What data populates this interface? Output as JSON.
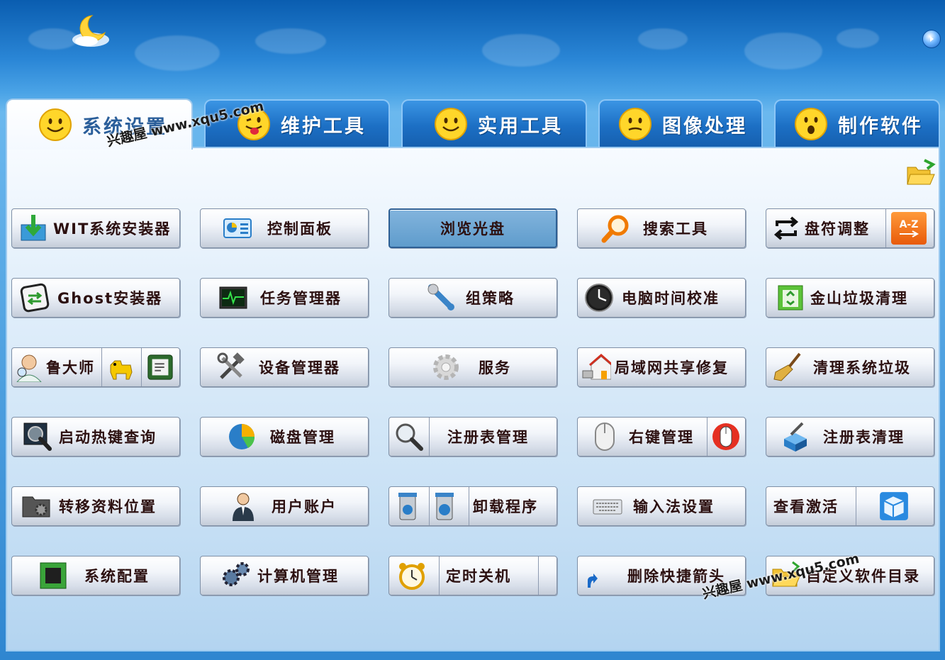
{
  "tabs": [
    {
      "label": "系统设置",
      "active": true
    },
    {
      "label": "维护工具",
      "active": false
    },
    {
      "label": "实用工具",
      "active": false
    },
    {
      "label": "图像处理",
      "active": false
    },
    {
      "label": "制作软件",
      "active": false
    }
  ],
  "watermark": "兴趣屋 www.xqu5.com",
  "buttons": {
    "wit": "WIT系统安装器",
    "control_panel": "控制面板",
    "browse_disc": "浏览光盘",
    "search_tool": "搜索工具",
    "drive_letter": "盘符调整",
    "az": "A-Z",
    "ghost": "Ghost安装器",
    "task_manager": "任务管理器",
    "group_policy": "组策略",
    "time_sync": "电脑时间校准",
    "kingsoft_clean": "金山垃圾清理",
    "ludashi": "鲁大师",
    "device_manager": "设备管理器",
    "services": "服务",
    "lan_repair": "局域网共享修复",
    "clean_junk": "清理系统垃圾",
    "hotkey": "启动热键查询",
    "disk_manager": "磁盘管理",
    "regedit": "注册表管理",
    "right_click": "右键管理",
    "reg_clean": "注册表清理",
    "move_data": "转移资料位置",
    "user_account": "用户账户",
    "uninstall": "卸载程序",
    "ime": "输入法设置",
    "activation": "查看激活",
    "sys_config": "系统配置",
    "comp_manage": "计算机管理",
    "shutdown": "定时关机",
    "delete_shortcut": "删除快捷箭头",
    "custom_dir": "自定义软件目录"
  }
}
